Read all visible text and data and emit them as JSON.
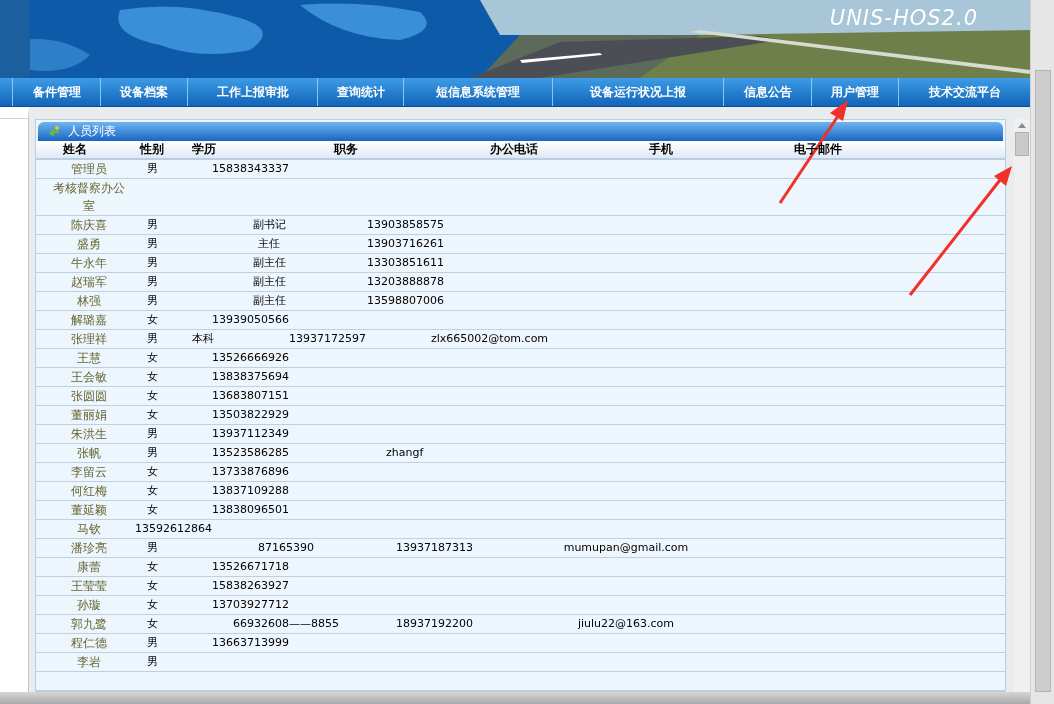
{
  "banner": {
    "logo": "UNIS-HOS2.0"
  },
  "nav": [
    "备件管理",
    "设备档案",
    "工作上报审批",
    "查询统计",
    "短信息系统管理",
    "设备运行状况上报",
    "信息公告",
    "用户管理",
    "技术交流平台"
  ],
  "panel": {
    "title": "人员列表",
    "columns": [
      "姓名",
      "性别",
      "学历",
      "职务",
      "办公电话",
      "手机",
      "电子邮件"
    ],
    "rows": [
      {
        "kind": "sex-phone",
        "cells": [
          "管理员",
          "男",
          "15838343337"
        ]
      },
      {
        "kind": "name",
        "cells": [
          "考核督察办公室"
        ]
      },
      {
        "kind": "sex-title-phone",
        "cells": [
          "陈庆喜",
          "男",
          "副书记",
          "13903858575"
        ]
      },
      {
        "kind": "sex-title-phone",
        "cells": [
          "盛勇",
          "男",
          "主任",
          "13903716261"
        ]
      },
      {
        "kind": "sex-title-phone",
        "cells": [
          "牛永年",
          "男",
          "副主任",
          "13303851611"
        ]
      },
      {
        "kind": "sex-title-phone",
        "cells": [
          "赵瑞军",
          "男",
          "副主任",
          "13203888878"
        ]
      },
      {
        "kind": "sex-title-phone",
        "cells": [
          "林强",
          "男",
          "副主任",
          "13598807006"
        ]
      },
      {
        "kind": "sex-phone",
        "cells": [
          "解璐嘉",
          "女",
          "13939050566"
        ]
      },
      {
        "kind": "sex-edu-phone-email",
        "cells": [
          "张理祥",
          "男",
          "本科",
          "13937172597",
          "zlx665002@tom.com"
        ]
      },
      {
        "kind": "sex-phone",
        "cells": [
          "王慧",
          "女",
          "13526666926"
        ]
      },
      {
        "kind": "sex-phone",
        "cells": [
          "王会敏",
          "女",
          "13838375694"
        ]
      },
      {
        "kind": "sex-phone",
        "cells": [
          "张圆圆",
          "女",
          "13683807151"
        ]
      },
      {
        "kind": "sex-phone",
        "cells": [
          "董丽娟",
          "女",
          "13503822929"
        ]
      },
      {
        "kind": "sex-phone",
        "cells": [
          "朱洪生",
          "男",
          "13937112349"
        ]
      },
      {
        "kind": "sex-phone-email",
        "cells": [
          "张帆",
          "男",
          "13523586285",
          "zhangf"
        ]
      },
      {
        "kind": "sex-phone",
        "cells": [
          "李留云",
          "女",
          "13733876896"
        ]
      },
      {
        "kind": "sex-phone",
        "cells": [
          "何红梅",
          "女",
          "13837109288"
        ]
      },
      {
        "kind": "sex-phone",
        "cells": [
          "董延颖",
          "女",
          "13838096501"
        ]
      },
      {
        "kind": "phone",
        "cells": [
          "马钦",
          "13592612864"
        ]
      },
      {
        "kind": "sex-office-mobile-email",
        "cells": [
          "潘珍亮",
          "男",
          "87165390",
          "13937187313",
          "mumupan@gmail.com"
        ]
      },
      {
        "kind": "sex-phone",
        "cells": [
          "康蕾",
          "女",
          "13526671718"
        ]
      },
      {
        "kind": "sex-phone",
        "cells": [
          "王莹莹",
          "女",
          "15838263927"
        ]
      },
      {
        "kind": "sex-phone",
        "cells": [
          "孙璇",
          "女",
          "13703927712"
        ]
      },
      {
        "kind": "sex-office-mobile-email",
        "cells": [
          "郭九鹭",
          "女",
          "66932608——8855",
          "18937192200",
          "jiulu22@163.com"
        ]
      },
      {
        "kind": "sex-phone",
        "cells": [
          "程仁德",
          "男",
          "13663713999"
        ]
      },
      {
        "kind": "sex",
        "cells": [
          "李岩",
          "男"
        ]
      }
    ]
  }
}
